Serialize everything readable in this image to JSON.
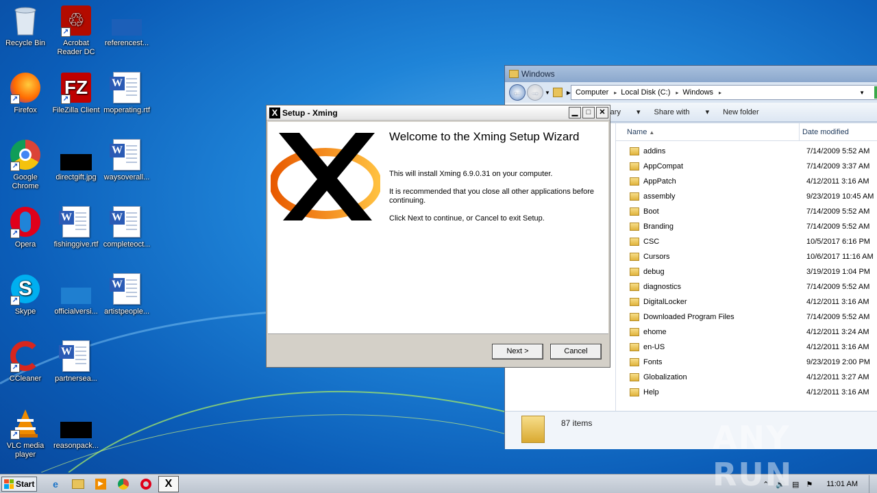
{
  "desktop": {
    "icons": [
      {
        "label": "Recycle Bin",
        "icon": "recycle-bin-icon"
      },
      {
        "label": "Acrobat Reader DC",
        "icon": "acrobat-icon"
      },
      {
        "label": "referencest...",
        "icon": "blank-file-icon"
      },
      {
        "label": "Firefox",
        "icon": "firefox-icon"
      },
      {
        "label": "FileZilla Client",
        "icon": "filezilla-icon"
      },
      {
        "label": "moperating.rtf",
        "icon": "word-doc-icon"
      },
      {
        "label": "Google Chrome",
        "icon": "chrome-icon"
      },
      {
        "label": "directgift.jpg",
        "icon": "image-file-icon"
      },
      {
        "label": "waysoverall...",
        "icon": "word-doc-icon"
      },
      {
        "label": "Opera",
        "icon": "opera-icon"
      },
      {
        "label": "fishinggive.rtf",
        "icon": "word-doc-icon"
      },
      {
        "label": "completeoct...",
        "icon": "word-doc-icon"
      },
      {
        "label": "Skype",
        "icon": "skype-icon"
      },
      {
        "label": "officialversi...",
        "icon": "blank-file-icon"
      },
      {
        "label": "artistpeople...",
        "icon": "word-doc-icon"
      },
      {
        "label": "CCleaner",
        "icon": "ccleaner-icon"
      },
      {
        "label": "partnersea...",
        "icon": "word-doc-icon"
      },
      {
        "label": "VLC media player",
        "icon": "vlc-icon"
      },
      {
        "label": "reasonpack...",
        "icon": "image-file-icon"
      }
    ]
  },
  "explorer": {
    "title": "Windows",
    "address": {
      "crumbs": [
        "Computer",
        "Local Disk (C:)",
        "Windows"
      ]
    },
    "toolbar": {
      "library": "rary",
      "share": "Share with",
      "new_folder": "New folder"
    },
    "columns": {
      "name": "Name",
      "date": "Date modified"
    },
    "files": [
      {
        "name": "addins",
        "date": "7/14/2009 5:52 AM"
      },
      {
        "name": "AppCompat",
        "date": "7/14/2009 3:37 AM"
      },
      {
        "name": "AppPatch",
        "date": "4/12/2011 3:16 AM"
      },
      {
        "name": "assembly",
        "date": "9/23/2019 10:45 AM"
      },
      {
        "name": "Boot",
        "date": "7/14/2009 5:52 AM"
      },
      {
        "name": "Branding",
        "date": "7/14/2009 5:52 AM"
      },
      {
        "name": "CSC",
        "date": "10/5/2017 6:16 PM"
      },
      {
        "name": "Cursors",
        "date": "10/6/2017 11:16 AM"
      },
      {
        "name": "debug",
        "date": "3/19/2019 1:04 PM"
      },
      {
        "name": "diagnostics",
        "date": "7/14/2009 5:52 AM"
      },
      {
        "name": "DigitalLocker",
        "date": "4/12/2011 3:16 AM"
      },
      {
        "name": "Downloaded Program Files",
        "date": "7/14/2009 5:52 AM"
      },
      {
        "name": "ehome",
        "date": "4/12/2011 3:24 AM"
      },
      {
        "name": "en-US",
        "date": "4/12/2011 3:16 AM"
      },
      {
        "name": "Fonts",
        "date": "9/23/2019 2:00 PM"
      },
      {
        "name": "Globalization",
        "date": "4/12/2011 3:27 AM"
      },
      {
        "name": "Help",
        "date": "4/12/2011 3:16 AM"
      }
    ],
    "status": "87 items"
  },
  "setup": {
    "title": "Setup - Xming",
    "heading": "Welcome to the Xming Setup Wizard",
    "para1": "This will install Xming 6.9.0.31 on your computer.",
    "para2": "It is recommended that you close all other applications before continuing.",
    "para3": "Click Next to continue, or Cancel to exit Setup.",
    "next": "Next >",
    "cancel": "Cancel"
  },
  "taskbar": {
    "start": "Start",
    "clock": "11:01 AM"
  },
  "watermark": "ANY RUN"
}
